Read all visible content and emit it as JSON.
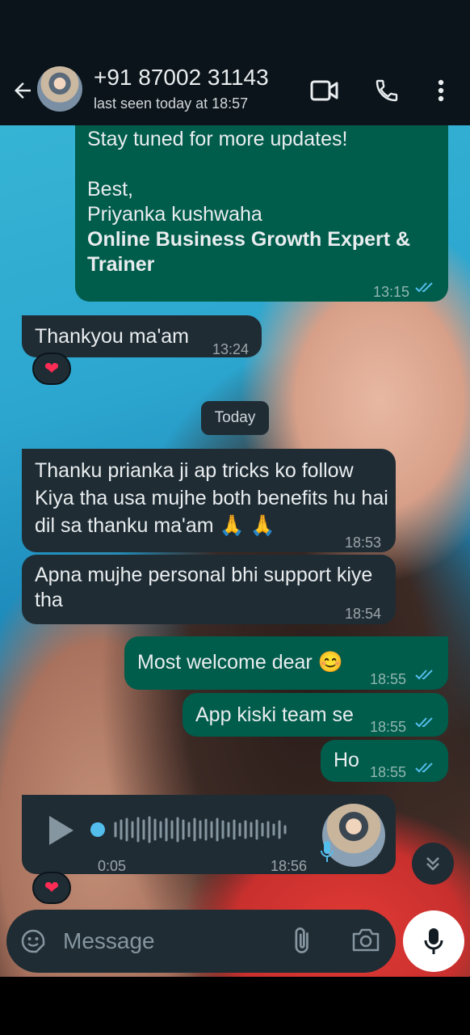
{
  "header": {
    "contact_name": "+91 87002 31143",
    "status": "last seen today at 18:57"
  },
  "messages": [
    {
      "direction": "outgoing",
      "lines": [
        "Stay tuned for more updates!",
        "",
        "Best,",
        "Priyanka kushwaha"
      ],
      "bold_text": "Online Business Growth Expert & Trainer",
      "time": "13:15",
      "read": true
    },
    {
      "direction": "incoming",
      "text": "Thankyou ma'am",
      "time": "13:24",
      "reaction": "❤"
    },
    {
      "direction": "incoming",
      "text": "Thanku prianka ji ap tricks ko follow Kiya tha usa mujhe both benefits hu hai dil sa thanku ma'am 🙏 🙏",
      "time": "18:53"
    },
    {
      "direction": "incoming",
      "text": "Apna mujhe personal bhi support kiye tha",
      "time": "18:54"
    },
    {
      "direction": "outgoing",
      "text": "Most welcome dear 😊",
      "time": "18:55",
      "read": true
    },
    {
      "direction": "outgoing",
      "text": "App kiski team se",
      "time": "18:55",
      "read": true
    },
    {
      "direction": "outgoing",
      "text": "Ho",
      "time": "18:55",
      "read": true
    },
    {
      "direction": "incoming",
      "type": "voice",
      "duration": "0:05",
      "time": "18:56",
      "reaction": "❤"
    }
  ],
  "date_separator": "Today",
  "composer": {
    "placeholder": "Message"
  },
  "colors": {
    "header_bg": "#0b141a",
    "incoming_bubble": "#1f2c34",
    "outgoing_bubble": "#005c4b",
    "read_tick": "#53bdeb",
    "voice_progress": "#53bdeb",
    "reaction_heart": "#ff2d55"
  },
  "icons": {
    "back": "arrow-left-icon",
    "video": "video-camera-icon",
    "call": "phone-icon",
    "menu": "vertical-dots-icon",
    "play": "play-icon",
    "voice_mic": "microphone-icon",
    "scroll": "double-chevron-down-icon",
    "sticker": "sticker-icon",
    "attach": "paperclip-icon",
    "camera": "camera-icon",
    "record": "microphone-icon"
  }
}
